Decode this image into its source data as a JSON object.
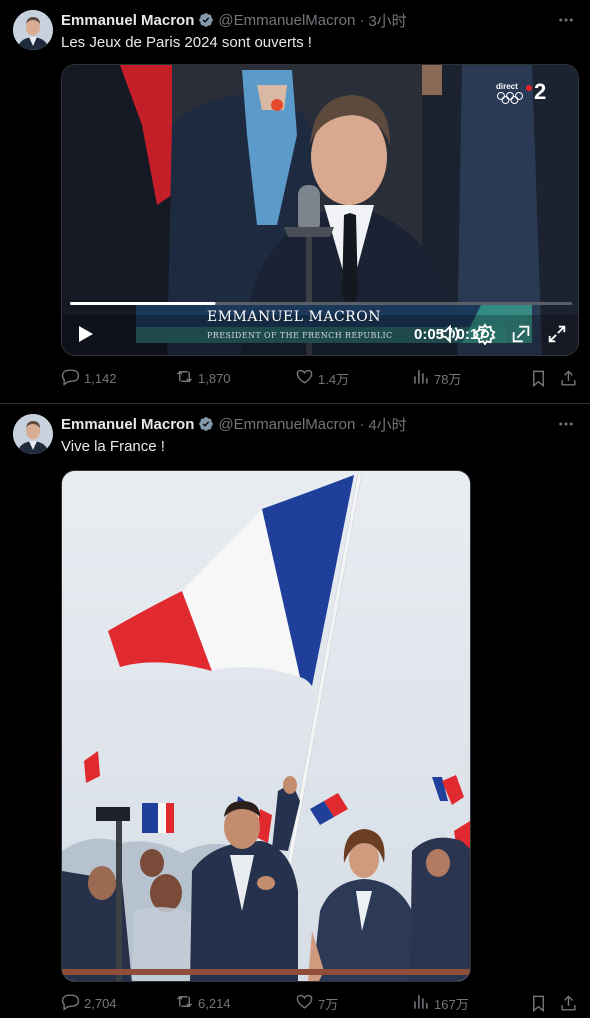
{
  "tweets": [
    {
      "author_name": "Emmanuel Macron",
      "handle": "@EmmanuelMacron",
      "separator": "·",
      "time": "3小时",
      "text": "Les Jeux de Paris 2024 sont ouverts !",
      "media": {
        "type": "video",
        "channel_label": "direct",
        "channel_number": "2",
        "lower_third_name": "EMMANUEL MACRON",
        "lower_third_title": "PRESIDENT OF THE FRENCH REPUBLIC",
        "current_time": "0:05",
        "duration": "0:17",
        "time_display": "0:05 / 0:17",
        "progress": 0.29
      },
      "stats": {
        "replies": "1,142",
        "reposts": "1,870",
        "likes": "1.4万",
        "views": "78万"
      }
    },
    {
      "author_name": "Emmanuel Macron",
      "handle": "@EmmanuelMacron",
      "separator": "·",
      "time": "4小时",
      "text": "Vive la France !",
      "media": {
        "type": "photo"
      },
      "stats": {
        "replies": "2,704",
        "reposts": "6,214",
        "likes": "7万",
        "views": "167万"
      }
    }
  ],
  "icons": {
    "verified": "verified-badge-icon",
    "more": "more-icon",
    "reply": "reply-icon",
    "repost": "repost-icon",
    "like": "like-icon",
    "views": "views-icon",
    "bookmark": "bookmark-icon",
    "share": "share-icon",
    "play": "play-icon",
    "volume": "volume-icon",
    "settings": "settings-icon",
    "pip": "picture-in-picture-icon",
    "fullscreen": "fullscreen-icon"
  },
  "colors": {
    "background": "#000000",
    "text": "#e7e9ea",
    "secondary_text": "#71767b",
    "divider": "#2f3336",
    "verified_badge": "#829aab"
  }
}
